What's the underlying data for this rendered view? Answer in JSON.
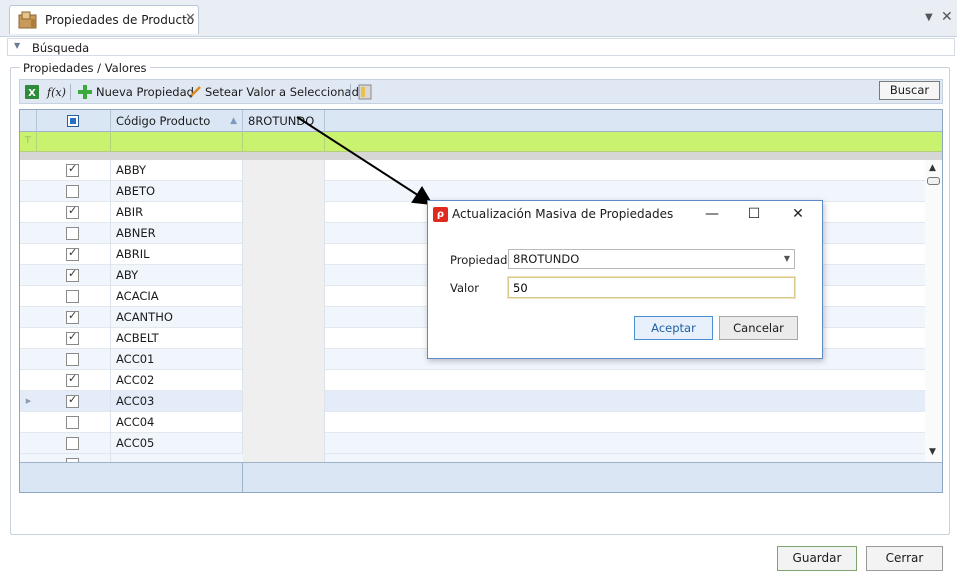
{
  "tab": {
    "title": "Propiedades de Producto",
    "close_glyph": "✕"
  },
  "window_controls": {
    "menu_glyph": "▼",
    "close_glyph": "✕"
  },
  "search_section": {
    "label": "Búsqueda"
  },
  "group": {
    "label": "Propiedades / Valores"
  },
  "toolbar": {
    "new_property": "Nueva Propiedad",
    "set_value": "Setear Valor a Seleccionadas",
    "search_button": "Buscar"
  },
  "grid": {
    "columns": [
      "Código Producto",
      "8ROTUNDO"
    ],
    "rows": [
      {
        "code": "ABBY",
        "checked": true
      },
      {
        "code": "ABETO",
        "checked": false
      },
      {
        "code": "ABIR",
        "checked": true
      },
      {
        "code": "ABNER",
        "checked": false
      },
      {
        "code": "ABRIL",
        "checked": true
      },
      {
        "code": "ABY",
        "checked": true
      },
      {
        "code": "ACACIA",
        "checked": false
      },
      {
        "code": "ACANTHO",
        "checked": true
      },
      {
        "code": "ACBELT",
        "checked": true
      },
      {
        "code": "ACC01",
        "checked": false
      },
      {
        "code": "ACC02",
        "checked": true
      },
      {
        "code": "ACC03",
        "checked": true
      },
      {
        "code": "ACC04",
        "checked": false
      },
      {
        "code": "ACC05",
        "checked": false
      }
    ]
  },
  "footer": {
    "save": "Guardar",
    "close": "Cerrar"
  },
  "dialog": {
    "title": "Actualización Masiva de Propiedades",
    "property_label": "Propiedad",
    "property_value": "8ROTUNDO",
    "value_label": "Valor",
    "value_input": "50",
    "accept": "Aceptar",
    "cancel": "Cancelar"
  },
  "colors": {
    "filter_row": "#c9f26e",
    "header_bg": "#dbe6f4",
    "accent": "#4a8fd6",
    "arrow": "#000000"
  }
}
